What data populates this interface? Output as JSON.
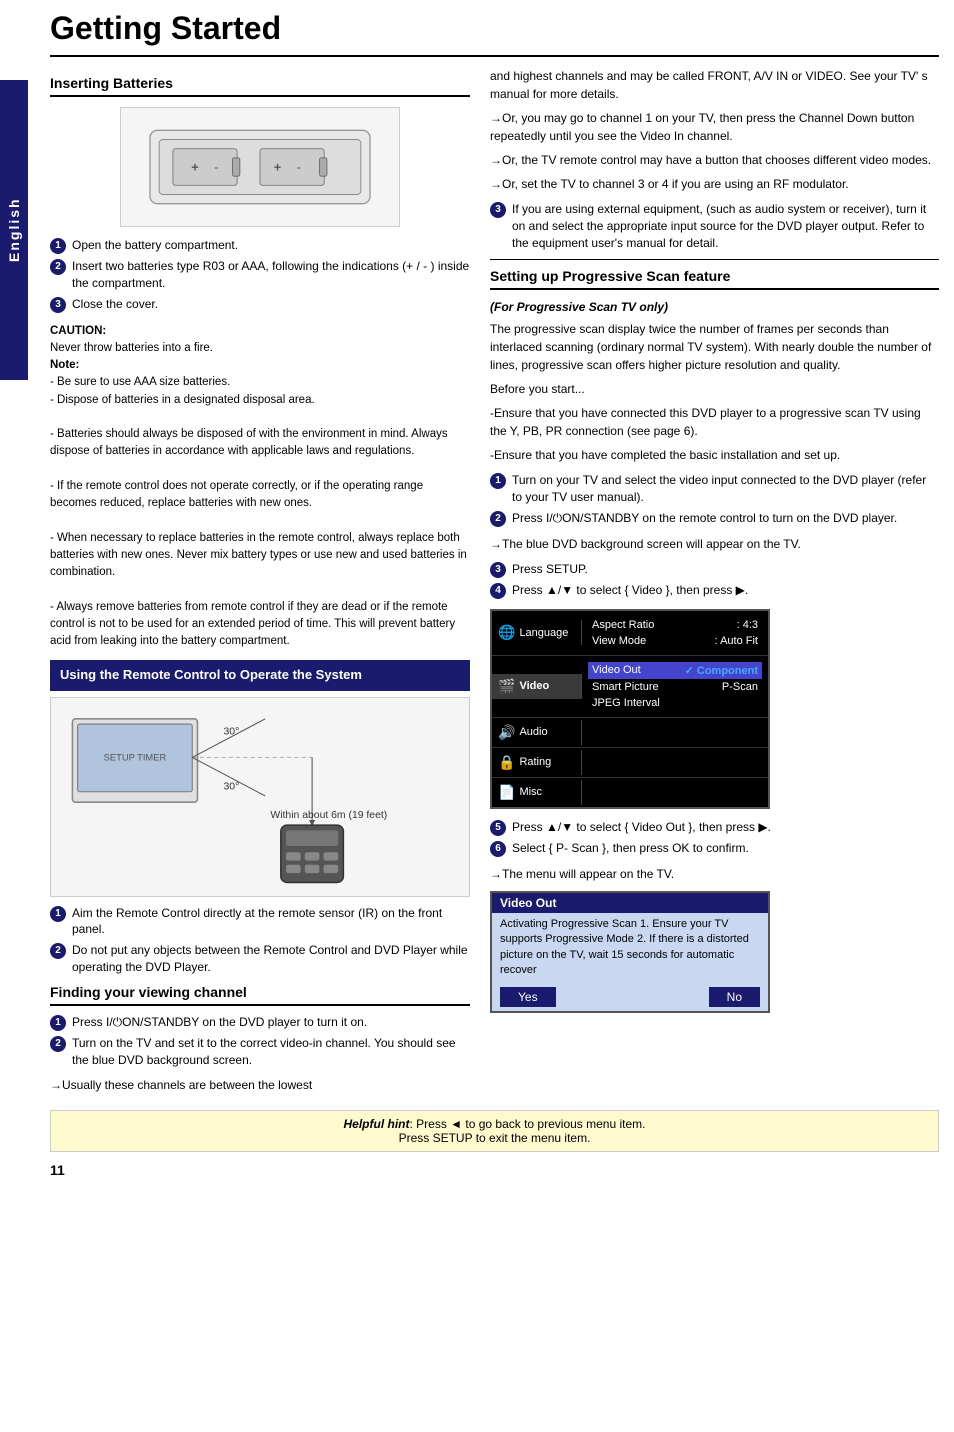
{
  "page": {
    "title": "Getting Started",
    "page_number": "11"
  },
  "sidebar": {
    "label": "English"
  },
  "inserting_batteries": {
    "heading": "Inserting Batteries",
    "steps": [
      "Open the battery compartment.",
      "Insert two batteries type R03 or AAA, following the indications (+ / - ) inside the compartment.",
      "Close the cover."
    ],
    "caution": {
      "title": "CAUTION:",
      "line1": "Never throw batteries into a fire.",
      "note_title": "Note:",
      "notes": [
        "- Be sure to use AAA size batteries.",
        "- Dispose of batteries in a designated disposal area.",
        "- Batteries should always be disposed of with the environment in mind. Always dispose of batteries in accordance with applicable laws and regulations.",
        "- If the remote control does not operate correctly, or if the operating range becomes reduced, replace batteries with new ones.",
        "- When necessary to replace batteries in the remote control, always replace both batteries with new ones. Never mix battery types or use new and used batteries in combination.",
        "- Always remove batteries from remote control if they are dead or if the remote control is not to be used for an extended period of time. This will prevent battery acid from leaking into the battery compartment."
      ]
    }
  },
  "using_remote": {
    "heading": "Using the Remote Control to Operate the System",
    "diagram_labels": {
      "angle": "30°",
      "angle2": "30°",
      "distance": "Within about 6m (19 feet)"
    },
    "steps": [
      "Aim the Remote Control directly at the remote sensor (IR) on the front panel.",
      "Do not put any objects between the Remote Control and DVD Player while operating the DVD Player."
    ]
  },
  "finding_channel": {
    "heading": "Finding your viewing channel",
    "steps": [
      "Press I/⏻ON/STANDBY on the DVD player to turn it on.",
      "Turn on the TV and set it to the correct video-in channel. You should see the blue DVD background screen."
    ],
    "arrow_text": "→Usually these channels are between the lowest"
  },
  "right_column": {
    "continued_text": "and highest channels and may be called FRONT, A/V IN or VIDEO. See your TV' s manual for more details.",
    "bullet1": "→Or, you may go to channel 1 on your TV, then press the Channel Down button repeatedly until you see the Video In channel.",
    "bullet2": "→Or, the TV remote control may have a button that chooses different video modes.",
    "bullet3": "→Or, set the TV to channel 3 or 4 if you are using an RF modulator.",
    "step3_text": "If you are using external equipment, (such as audio  system or receiver), turn it on and select the appropriate input source for the DVD player output. Refer to the equipment user's manual for detail."
  },
  "progressive_scan": {
    "heading": "Setting up Progressive Scan feature",
    "for_tv_label": "(For Progressive Scan TV only)",
    "description": "The progressive scan display twice the number of frames per seconds than interlaced scanning (ordinary normal TV system). With nearly double the number of lines, progressive scan offers higher picture resolution and quality.",
    "before_start": "Before you start...",
    "ensure1": "-Ensure that you have connected this DVD player to a progressive scan TV using the Y, PB, PR connection (see page 6).",
    "ensure2": "-Ensure that you have completed the basic installation and set up.",
    "steps": [
      "Turn on your TV and select the video input connected to the DVD player (refer to your TV user manual).",
      "Press I/⏻ON/STANDBY on the remote control to turn on the DVD player.",
      "Press SETUP.",
      "Press ▲/▼ to select { Video }, then press ▶."
    ],
    "arrow_blue": "→The blue DVD background screen will appear on the TV.",
    "step5": "Press ▲/▼ to select { Video Out }, then press ▶.",
    "step6": "Select { P- Scan }, then press OK to confirm.",
    "arrow_menu": "→The menu will appear on the TV.",
    "menu": {
      "title": "Video Out",
      "sections": [
        {
          "icon": "Language",
          "rows": [
            {
              "label": "Aspect Ratio",
              "value": ": 4:3"
            },
            {
              "label": "View Mode",
              "value": ": Auto Fit"
            }
          ]
        },
        {
          "icon": "Video",
          "rows": [
            {
              "label": "Video Out",
              "value": "✓ Component",
              "highlighted": true
            },
            {
              "label": "Smart Picture",
              "value": "P-Scan"
            },
            {
              "label": "JPEG Interval",
              "value": ""
            }
          ]
        },
        {
          "icon": "Audio",
          "rows": []
        },
        {
          "icon": "Rating",
          "rows": []
        },
        {
          "icon": "Misc",
          "rows": []
        }
      ]
    },
    "video_out_dialog": {
      "title": "Video Out",
      "body": "Activating Progressive Scan 1. Ensure your TV supports Progressive Mode 2. If there is a distorted picture on the TV, wait 15 seconds for automatic recover",
      "yes_label": "Yes",
      "no_label": "No"
    }
  },
  "helpful_hint": {
    "label": "Helpful hint",
    "text1": ": Press ◄ to go back to previous menu item.",
    "text2": "Press SETUP to exit the menu item."
  }
}
